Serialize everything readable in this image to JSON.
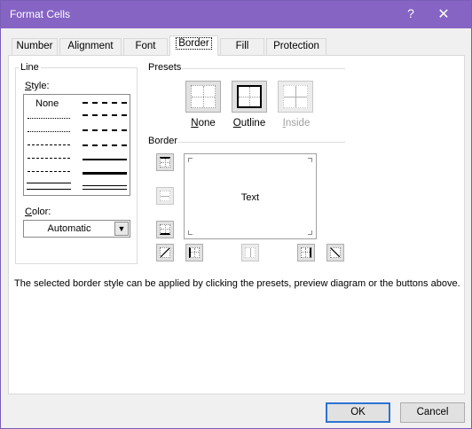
{
  "window": {
    "title": "Format Cells",
    "help_glyph": "?",
    "close_glyph": "✕"
  },
  "tabs": [
    {
      "label": "Number"
    },
    {
      "label": "Alignment"
    },
    {
      "label": "Font"
    },
    {
      "label": "Border",
      "active": true
    },
    {
      "label": "Fill"
    },
    {
      "label": "Protection"
    }
  ],
  "line_group": {
    "title": "Line",
    "style_label": "Style:",
    "none_label": "None",
    "color_label": "Color:",
    "color_value": "Automatic"
  },
  "presets": {
    "title": "Presets",
    "items": [
      {
        "label": "None",
        "enabled": true
      },
      {
        "label": "Outline",
        "enabled": true
      },
      {
        "label": "Inside",
        "enabled": false
      }
    ]
  },
  "border": {
    "title": "Border",
    "preview_text": "Text"
  },
  "hint_text": "The selected border style can be applied by clicking the presets, preview diagram or the buttons above.",
  "buttons": {
    "ok": "OK",
    "cancel": "Cancel"
  },
  "colors": {
    "titlebar": "#8664c4",
    "default_button_border": "#2c73d1"
  }
}
